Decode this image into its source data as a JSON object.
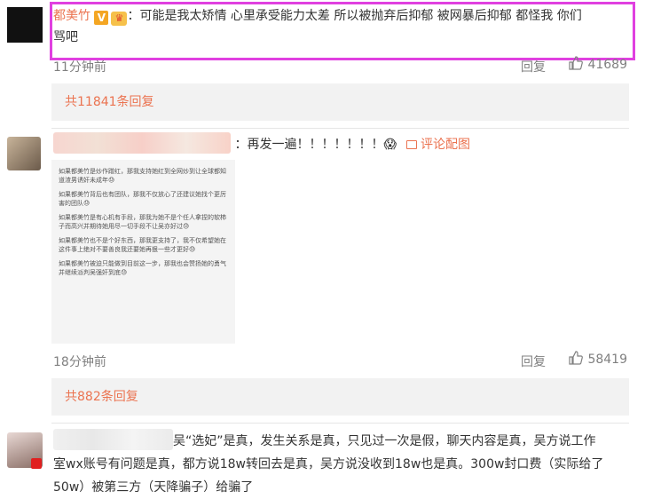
{
  "comment1": {
    "username": "都美竹",
    "verified_badge": "V",
    "text_line1": "：可能是我太矫情 心里承受能力太差 所以被抛弃后抑郁 被网暴后抑郁 都怪我 你们",
    "text_line2": "骂吧",
    "time": "11分钟前",
    "reply_label": "回复",
    "like_count": "41689",
    "replies_summary": "共11841条回复"
  },
  "comment2": {
    "text": "：再发一遍！！！！！！！😱",
    "image_link": "评论配图",
    "image_paragraphs": [
      "如果都美竹是炒作蹭红，那我支持她红到全网炒到让全球都知道渣男诱奸未成年😓",
      "如果都美竹背后也有团队，那我不仅放心了还建议她找个更厉害的团队😓",
      "如果都美竹是有心机有手段，那我为她不是个任人拿捏的软柿子而高兴并期待她用尽一切手段不让吴亦好过😓",
      "如果都美竹也不是个好东西，那我更支持了，我不仅希望她在这件事上绝对不要善良我还要她再狠一些才更好😓",
      "如果都美竹被迫只能做到目前这一步，那我也会赞扬她的勇气并继续派判吴强奸到底😓"
    ],
    "time": "18分钟前",
    "reply_label": "回复",
    "like_count": "58419",
    "replies_summary": "共882条回复"
  },
  "comment3": {
    "text_line1": "吴“选妃”是真，发生关系是真，只见过一次是假，聊天内容是真，吴方说工作",
    "text_line2": "室wx账号有问题是真，都方说18w转回去是真，吴方说没收到18w也是真。300w封口费（实际给了",
    "text_line3": "50w）被第三方（天降骗子）给骗了"
  },
  "colors": {
    "accent": "#eb7350",
    "highlight_border": "#e040e0",
    "meta": "#808080",
    "reply_box_bg": "#f2f2f2"
  }
}
